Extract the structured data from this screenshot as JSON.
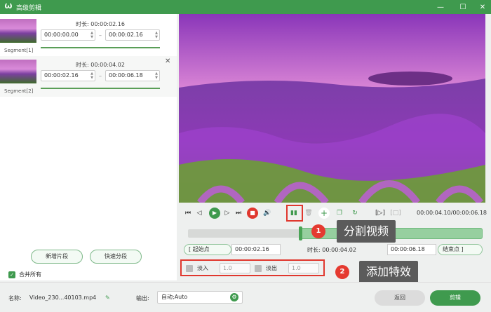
{
  "window": {
    "title": "高级剪辑",
    "minimize_icon": "minimize-icon",
    "maximize_icon": "maximize-icon",
    "close_icon": "close-icon"
  },
  "segments": [
    {
      "label": "Segment[1]",
      "duration_label": "时长:",
      "duration": "00:00:02.16",
      "start": "00:00:00.00",
      "end": "00:00:02.16",
      "separator": "–"
    },
    {
      "label": "Segment[2]",
      "duration_label": "时长:",
      "duration": "00:00:04.02",
      "start": "00:00:02.16",
      "end": "00:00:06.18",
      "separator": "–"
    }
  ],
  "left_buttons": {
    "add_segment": "新增片段",
    "quick_split": "快速分段"
  },
  "merge_all": {
    "label": "合并所有",
    "checked": true
  },
  "player": {
    "current_time": "00:00:04.10",
    "total_time": "00:00:06.18",
    "time_separator": "/"
  },
  "range": {
    "start_btn": "起始点",
    "start_value": "00:00:02.16",
    "duration_label": "时长:",
    "duration_value": "00:00:04.02",
    "end_value": "00:00:06.18",
    "end_btn": "结束点"
  },
  "effects": {
    "fade_in_label": "淡入",
    "fade_in_value": "1.0",
    "fade_out_label": "淡出",
    "fade_out_value": "1.0"
  },
  "callouts": [
    {
      "number": "1",
      "text": "分割视频"
    },
    {
      "number": "2",
      "text": "添加特效"
    }
  ],
  "footer": {
    "name_label": "名称:",
    "file_name": "Video_230...40103.mp4",
    "output_label": "输出:",
    "output_value": "自动;Auto",
    "back": "返回",
    "cut": "剪辑"
  },
  "colors": {
    "accent": "#3f9a4e",
    "highlight": "#e0372e"
  }
}
